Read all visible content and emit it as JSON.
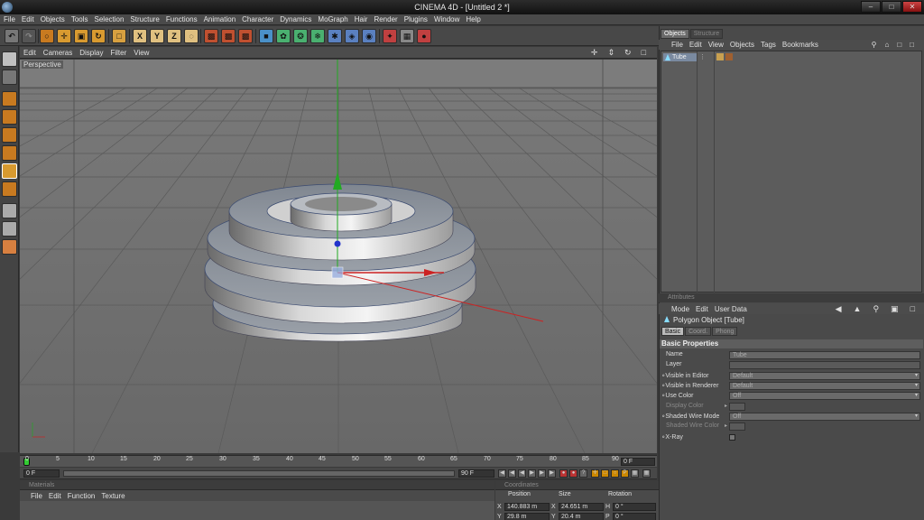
{
  "window": {
    "title": "CINEMA 4D - [Untitled 2 *]"
  },
  "menubar": [
    "File",
    "Edit",
    "Objects",
    "Tools",
    "Selection",
    "Structure",
    "Functions",
    "Animation",
    "Character",
    "Dynamics",
    "MoGraph",
    "Hair",
    "Render",
    "Plugins",
    "Window",
    "Help"
  ],
  "toolbar": {
    "axis_x": "X",
    "axis_y": "Y",
    "axis_z": "Z"
  },
  "viewport": {
    "menu": [
      "Edit",
      "Cameras",
      "Display",
      "Filter",
      "View"
    ],
    "label": "Perspective"
  },
  "timeline": {
    "ticks": [
      "0",
      "5",
      "10",
      "15",
      "20",
      "25",
      "30",
      "35",
      "40",
      "45",
      "50",
      "55",
      "60",
      "65",
      "70",
      "75",
      "80",
      "85",
      "90"
    ],
    "current_frame": "0 F",
    "start_frame": "0 F",
    "end_frame": "90 F"
  },
  "materials": {
    "header": "Materials",
    "menu": [
      "File",
      "Edit",
      "Function",
      "Texture"
    ]
  },
  "coordinates": {
    "header": "Coordinates",
    "columns": [
      "Position",
      "Size",
      "Rotation"
    ],
    "row_x": {
      "axis": "X",
      "position": "140.883 m",
      "size_axis": "X",
      "size": "24.651 m",
      "rot_axis": "H",
      "rotation": "0 °"
    },
    "row_y": {
      "axis": "Y",
      "position": "29.8 m",
      "size_axis": "Y",
      "size": "20.4 m",
      "rot_axis": "P",
      "rotation": "0 °"
    }
  },
  "object_manager": {
    "tabs": [
      "Objects",
      "Structure"
    ],
    "menu": [
      "File",
      "Edit",
      "View",
      "Objects",
      "Tags",
      "Bookmarks"
    ],
    "objects": [
      {
        "name": "Tube"
      }
    ]
  },
  "attributes": {
    "header": "Attributes",
    "menu": [
      "Mode",
      "Edit",
      "User Data"
    ],
    "object_title": "Polygon Object [Tube]",
    "tabs": [
      "Basic",
      "Coord.",
      "Phong"
    ],
    "section": "Basic Properties",
    "props": {
      "name_label": "Name",
      "name_value": "Tube",
      "layer_label": "Layer",
      "vis_editor_label": "Visible in Editor",
      "vis_editor_value": "Default",
      "vis_render_label": "Visible in Renderer",
      "vis_render_value": "Default",
      "use_color_label": "Use Color",
      "use_color_value": "Off",
      "display_color_label": "Display Color",
      "shaded_wire_label": "Shaded Wire Mode",
      "shaded_wire_value": "Off",
      "shaded_wire_color_label": "Shaded Wire Color",
      "xray_label": "X-Ray"
    }
  },
  "colors": {
    "accent_selection": "#7a8aa0",
    "axis_x": "#cc2222",
    "axis_y": "#22aa22",
    "axis_z": "#2233cc"
  }
}
